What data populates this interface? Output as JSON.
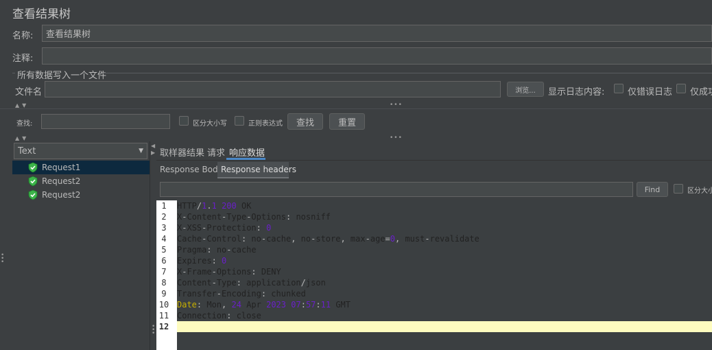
{
  "panel": {
    "title": "查看结果树",
    "name_label": "名称:",
    "name_value": "查看结果树",
    "comment_label": "注释:",
    "comment_value": ""
  },
  "file_section": {
    "legend": "所有数据写入一个文件",
    "filename_label": "文件名",
    "filename_value": "",
    "browse_label": "浏览...",
    "log_label": "显示日志内容:",
    "errors_only_label": "仅错误日志",
    "success_only_label": "仅成功"
  },
  "search": {
    "label": "查找:",
    "value": "",
    "case_label": "区分大小写",
    "regex_label": "正则表达式",
    "find_label": "查找",
    "reset_label": "重置"
  },
  "renderer": {
    "selected": "Text"
  },
  "tree": {
    "items": [
      {
        "label": "Request1",
        "selected": true,
        "status": "success"
      },
      {
        "label": "Request2",
        "selected": false,
        "status": "success"
      },
      {
        "label": "Request2",
        "selected": false,
        "status": "success"
      }
    ]
  },
  "result_tabs": {
    "items": [
      "取样器结果",
      "请求",
      "响应数据"
    ],
    "active": "响应数据"
  },
  "response_tabs": {
    "items": [
      "Response Body",
      "Response headers"
    ],
    "active": "Response headers"
  },
  "response_search": {
    "value": "",
    "find_label": "Find",
    "case_label": "区分大小写"
  },
  "headers": {
    "line_numbers": [
      "1",
      "2",
      "3",
      "4",
      "5",
      "6",
      "7",
      "8",
      "9",
      "10",
      "11",
      "12"
    ],
    "lines": [
      "HTTP/1.1 200 OK",
      "X-Content-Type-Options: nosniff",
      "X-XSS-Protection: 0",
      "Cache-Control: no-cache, no-store, max-age=0, must-revalidate",
      "Pragma: no-cache",
      "Expires: 0",
      "X-Frame-Options: DENY",
      "Content-Type: application/json",
      "Transfer-Encoding: chunked",
      "Date: Mon, 24 Apr 2023 07:57:11 GMT",
      "Connection: close",
      ""
    ],
    "current_line": "12"
  },
  "colors": {
    "background": "#3c3f41",
    "field_background": "#45494a",
    "selection": "#0d293e",
    "tab_underline": "#4a88c7",
    "editor_background": "#3b3f41",
    "current_line": "#fefcbf",
    "number_token": "#6a20c8",
    "date_token": "#c8b000",
    "success_icon": "#3cb44a"
  }
}
